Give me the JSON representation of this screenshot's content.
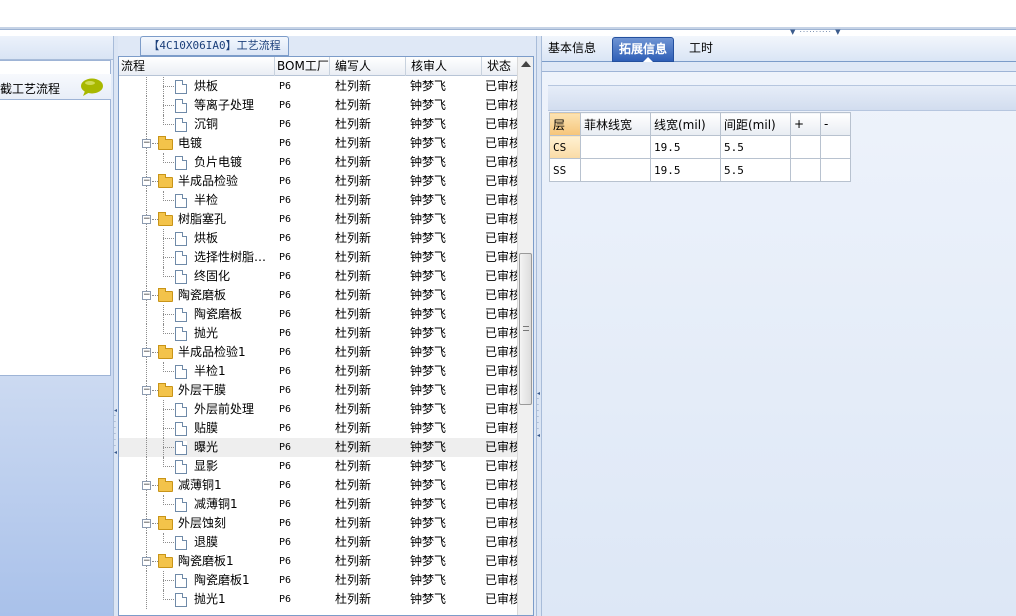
{
  "process_tab": {
    "title": "【4C10X06IA0】工艺流程"
  },
  "left_panel": {
    "title": "截工艺流程"
  },
  "grid": {
    "columns": [
      "流程",
      "BOM工厂",
      "编写人",
      "核审人",
      "状态"
    ],
    "rows": [
      {
        "label": "烘板",
        "level": 2,
        "bom": "P6",
        "writer": "杜列新",
        "reviewer": "钟梦飞",
        "status": "已审核"
      },
      {
        "label": "等离子处理",
        "level": 2,
        "bom": "P6",
        "writer": "杜列新",
        "reviewer": "钟梦飞",
        "status": "已审核"
      },
      {
        "label": "沉铜",
        "level": 2,
        "bom": "P6",
        "writer": "杜列新",
        "reviewer": "钟梦飞",
        "status": "已审核"
      },
      {
        "label": "电镀",
        "level": 1,
        "bom": "P6",
        "writer": "杜列新",
        "reviewer": "钟梦飞",
        "status": "已审核"
      },
      {
        "label": "负片电镀",
        "level": 2,
        "bom": "P6",
        "writer": "杜列新",
        "reviewer": "钟梦飞",
        "status": "已审核"
      },
      {
        "label": "半成品检验",
        "level": 1,
        "bom": "P6",
        "writer": "杜列新",
        "reviewer": "钟梦飞",
        "status": "已审核"
      },
      {
        "label": "半检",
        "level": 2,
        "bom": "P6",
        "writer": "杜列新",
        "reviewer": "钟梦飞",
        "status": "已审核"
      },
      {
        "label": "树脂塞孔",
        "level": 1,
        "bom": "P6",
        "writer": "杜列新",
        "reviewer": "钟梦飞",
        "status": "已审核"
      },
      {
        "label": "烘板",
        "level": 2,
        "bom": "P6",
        "writer": "杜列新",
        "reviewer": "钟梦飞",
        "status": "已审核"
      },
      {
        "label": "选择性树脂…",
        "level": 2,
        "bom": "P6",
        "writer": "杜列新",
        "reviewer": "钟梦飞",
        "status": "已审核"
      },
      {
        "label": "终固化",
        "level": 2,
        "bom": "P6",
        "writer": "杜列新",
        "reviewer": "钟梦飞",
        "status": "已审核"
      },
      {
        "label": "陶瓷磨板",
        "level": 1,
        "bom": "P6",
        "writer": "杜列新",
        "reviewer": "钟梦飞",
        "status": "已审核"
      },
      {
        "label": "陶瓷磨板",
        "level": 2,
        "bom": "P6",
        "writer": "杜列新",
        "reviewer": "钟梦飞",
        "status": "已审核"
      },
      {
        "label": "抛光",
        "level": 2,
        "bom": "P6",
        "writer": "杜列新",
        "reviewer": "钟梦飞",
        "status": "已审核"
      },
      {
        "label": "半成品检验1",
        "level": 1,
        "bom": "P6",
        "writer": "杜列新",
        "reviewer": "钟梦飞",
        "status": "已审核"
      },
      {
        "label": "半检1",
        "level": 2,
        "bom": "P6",
        "writer": "杜列新",
        "reviewer": "钟梦飞",
        "status": "已审核"
      },
      {
        "label": "外层干膜",
        "level": 1,
        "bom": "P6",
        "writer": "杜列新",
        "reviewer": "钟梦飞",
        "status": "已审核"
      },
      {
        "label": "外层前处理",
        "level": 2,
        "bom": "P6",
        "writer": "杜列新",
        "reviewer": "钟梦飞",
        "status": "已审核"
      },
      {
        "label": "贴膜",
        "level": 2,
        "bom": "P6",
        "writer": "杜列新",
        "reviewer": "钟梦飞",
        "status": "已审核"
      },
      {
        "label": "曝光",
        "level": 2,
        "bom": "P6",
        "writer": "杜列新",
        "reviewer": "钟梦飞",
        "status": "已审核",
        "selected": true
      },
      {
        "label": "显影",
        "level": 2,
        "bom": "P6",
        "writer": "杜列新",
        "reviewer": "钟梦飞",
        "status": "已审核"
      },
      {
        "label": "减薄铜1",
        "level": 1,
        "bom": "P6",
        "writer": "杜列新",
        "reviewer": "钟梦飞",
        "status": "已审核"
      },
      {
        "label": "减薄铜1",
        "level": 2,
        "bom": "P6",
        "writer": "杜列新",
        "reviewer": "钟梦飞",
        "status": "已审核"
      },
      {
        "label": "外层蚀刻",
        "level": 1,
        "bom": "P6",
        "writer": "杜列新",
        "reviewer": "钟梦飞",
        "status": "已审核"
      },
      {
        "label": "退膜",
        "level": 2,
        "bom": "P6",
        "writer": "杜列新",
        "reviewer": "钟梦飞",
        "status": "已审核"
      },
      {
        "label": "陶瓷磨板1",
        "level": 1,
        "bom": "P6",
        "writer": "杜列新",
        "reviewer": "钟梦飞",
        "status": "已审核"
      },
      {
        "label": "陶瓷磨板1",
        "level": 2,
        "bom": "P6",
        "writer": "杜列新",
        "reviewer": "钟梦飞",
        "status": "已审核"
      },
      {
        "label": "抛光1",
        "level": 2,
        "bom": "P6",
        "writer": "杜列新",
        "reviewer": "钟梦飞",
        "status": "已审核"
      }
    ]
  },
  "right_tabs": [
    {
      "label": "基本信息",
      "active": false
    },
    {
      "label": "拓展信息",
      "active": true
    },
    {
      "label": "工时",
      "active": false
    }
  ],
  "params_table": {
    "columns": [
      "层",
      "菲林线宽",
      "线宽(mil)",
      "间距(mil)",
      "+",
      "-"
    ],
    "rows": [
      {
        "layer": "CS",
        "film_width": "",
        "line_width": "19.5",
        "spacing": "5.5",
        "highlight": true
      },
      {
        "layer": "SS",
        "film_width": "",
        "line_width": "19.5",
        "spacing": "5.5",
        "highlight": false
      }
    ]
  },
  "icons": {
    "chat": "speech-bubble-icon",
    "folder": "folder-icon",
    "document": "document-icon",
    "collapse": "minus-box-icon",
    "scroll_up": "triangle-up-icon"
  },
  "colors": {
    "accent_tab": "#2f5fb7",
    "folder": "#f3c34a",
    "highlight_cell": "#f6c57a",
    "chat_icon": "#a8b800"
  }
}
